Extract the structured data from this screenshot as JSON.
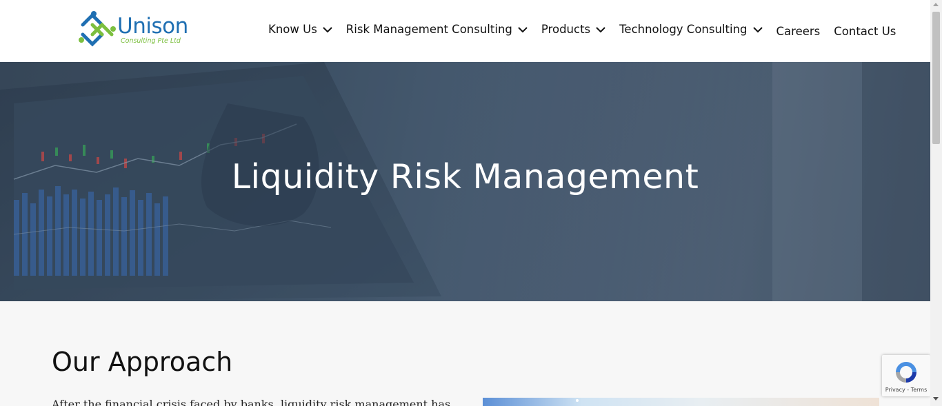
{
  "header": {
    "logo": {
      "name": "Unison",
      "tagline": "Consulting Pte Ltd"
    },
    "nav": [
      {
        "label": "Know Us",
        "dropdown": true
      },
      {
        "label": "Risk Management Consulting",
        "dropdown": true
      },
      {
        "label": "Products",
        "dropdown": true
      },
      {
        "label": "Technology Consulting",
        "dropdown": true
      },
      {
        "label": "Careers",
        "dropdown": false
      },
      {
        "label": "Contact Us",
        "dropdown": false
      }
    ]
  },
  "hero": {
    "title": "Liquidity Risk Management"
  },
  "main": {
    "section_title": "Our Approach",
    "section_text": "After the financial crisis faced by banks, liquidity risk management has"
  },
  "recaptcha": {
    "links": "Privacy - Terms"
  },
  "colors": {
    "brand_blue": "#1f6fb2",
    "brand_green": "#7cbf3f",
    "hero_overlay": "#3f5368"
  }
}
